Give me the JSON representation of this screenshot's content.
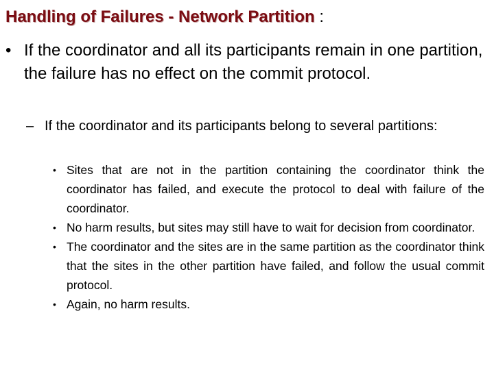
{
  "slide": {
    "title": "Handling of Failures - Network Partition",
    "title_suffix": " :",
    "colors": {
      "title": "#7a0c12",
      "text": "#000000",
      "background": "#ffffff"
    },
    "level1": {
      "bullet": "•",
      "text": "If the coordinator and all its participants remain in one partition, the failure has no effect on the commit protocol."
    },
    "level2": {
      "bullet": "–",
      "text": "If the coordinator and its participants belong to several partitions:"
    },
    "level3": [
      {
        "bullet": "•",
        "text": "Sites that are not in the partition containing the coordinator think the coordinator has failed, and execute the protocol to deal with failure of the coordinator."
      },
      {
        "bullet": "•",
        "text": "No harm results, but sites may still have to wait for decision from coordinator."
      },
      {
        "bullet": "•",
        "text": "The coordinator and the sites are in the same partition as the coordinator think that the sites in the other partition have failed, and follow the usual commit protocol."
      },
      {
        "bullet": "•",
        "text": "Again, no harm results."
      }
    ]
  }
}
